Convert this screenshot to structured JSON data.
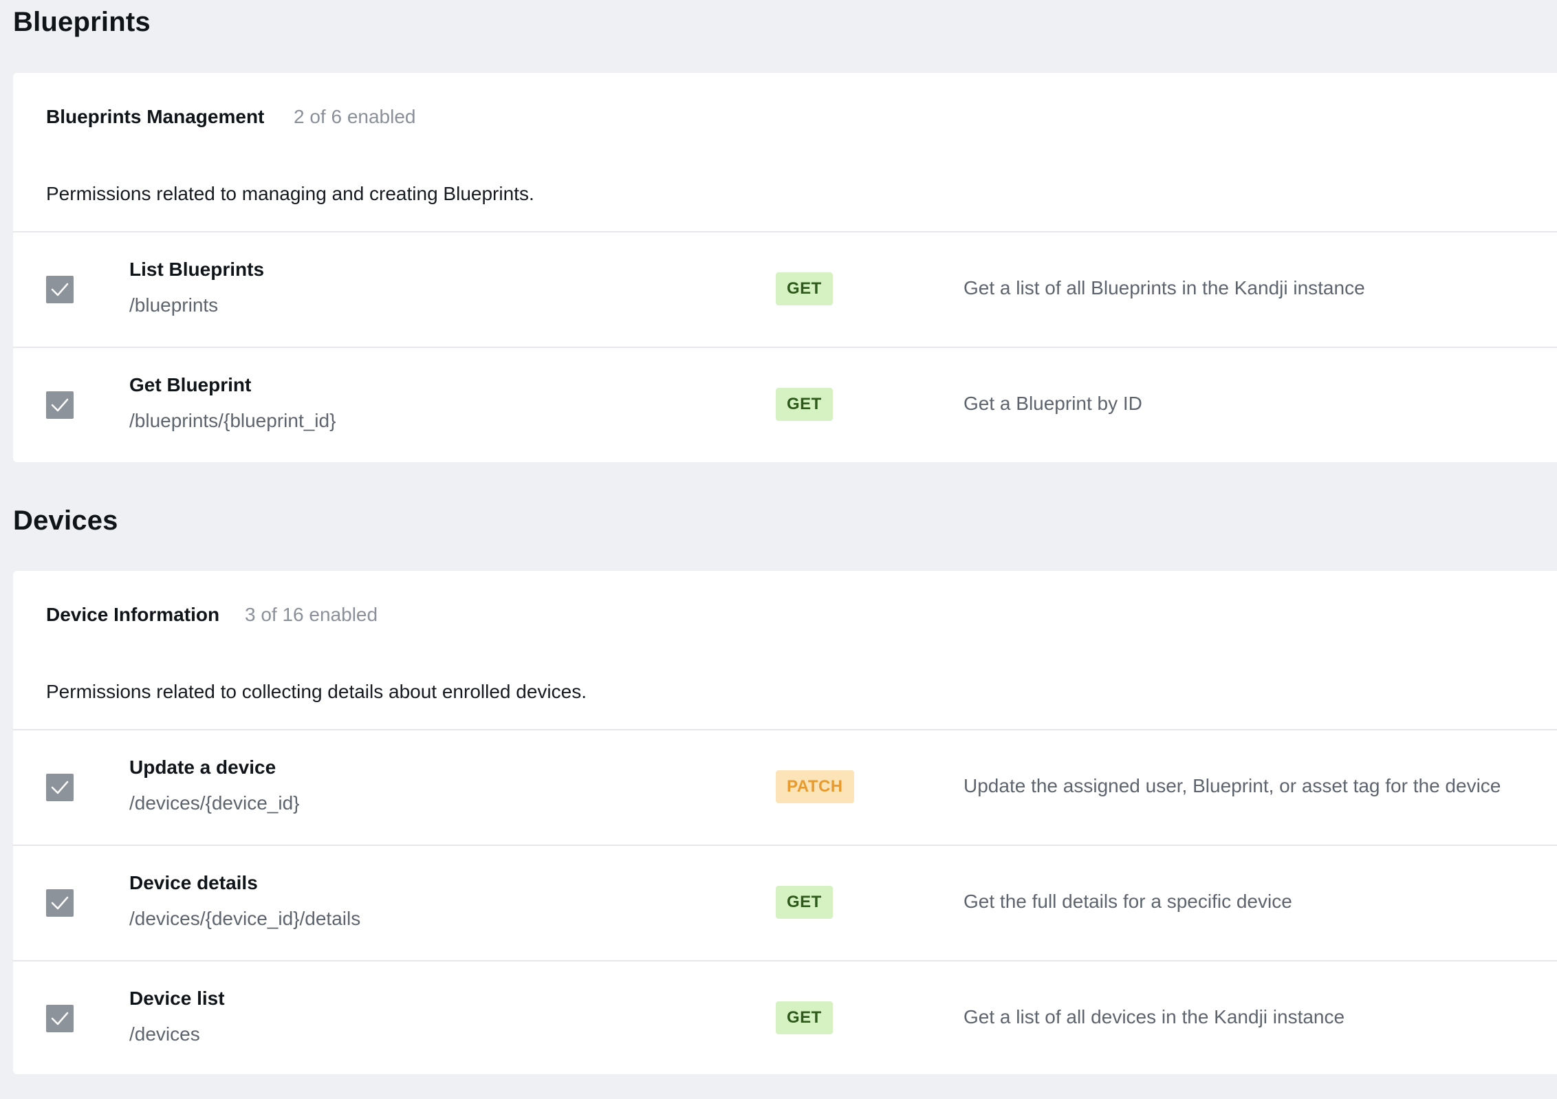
{
  "sections": [
    {
      "title": "Blueprints",
      "group": {
        "name": "Blueprints Management",
        "count": "2 of 6 enabled",
        "description": "Permissions related to managing and creating Blueprints.",
        "rows": [
          {
            "name": "List Blueprints",
            "path": "/blueprints",
            "method": "GET",
            "description": "Get a list of all Blueprints in the Kandji instance",
            "checked": true
          },
          {
            "name": "Get Blueprint",
            "path": "/blueprints/{blueprint_id}",
            "method": "GET",
            "description": "Get a Blueprint by ID",
            "checked": true
          }
        ]
      }
    },
    {
      "title": "Devices",
      "group": {
        "name": "Device Information",
        "count": "3 of 16 enabled",
        "description": "Permissions related to collecting details about enrolled devices.",
        "rows": [
          {
            "name": "Update a device",
            "path": "/devices/{device_id}",
            "method": "PATCH",
            "description": "Update the assigned user, Blueprint, or asset tag for the device",
            "checked": true
          },
          {
            "name": "Device details",
            "path": "/devices/{device_id}/details",
            "method": "GET",
            "description": "Get the full details for a specific device",
            "checked": true
          },
          {
            "name": "Device list",
            "path": "/devices",
            "method": "GET",
            "description": "Get a list of all devices in the Kandji instance",
            "checked": true
          }
        ]
      }
    }
  ],
  "colors": {
    "page_bg": "#eef0f4",
    "get_badge_bg": "#d7f2c2",
    "get_badge_text": "#2d5a1a",
    "patch_badge_bg": "#fde3b8",
    "patch_badge_text": "#e89a2e",
    "checkbox_bg": "#8d939a"
  },
  "icons": {
    "checkbox_mark": "check-icon"
  }
}
